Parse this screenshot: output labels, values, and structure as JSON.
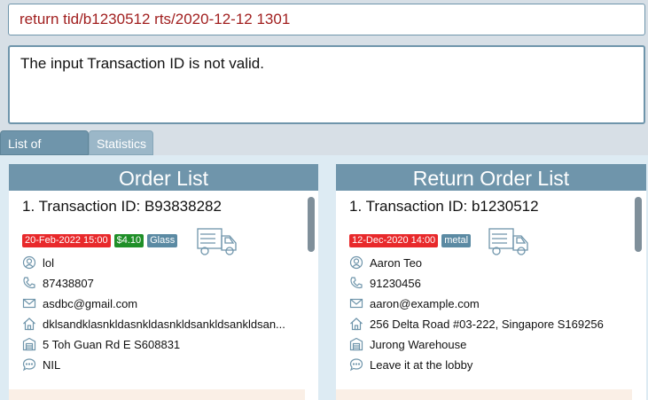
{
  "command": {
    "value": "return tid/b1230512 rts/2020-12-12 1301"
  },
  "result": {
    "text": "The input Transaction ID is not valid."
  },
  "tabs": [
    {
      "label": "List of Orders"
    },
    {
      "label": "Statistics"
    }
  ],
  "order_list": {
    "header": "Order List",
    "card": {
      "title": "1.  Transaction ID: B93838282",
      "tags": [
        {
          "text": "20-Feb-2022 15:00",
          "color": "#e8292b"
        },
        {
          "text": "$4.10",
          "color": "#1f8f28"
        },
        {
          "text": "Glass",
          "color": "#5b8aa3"
        }
      ],
      "truck_icon": "delivery-truck-icon",
      "name": "lol",
      "phone": "87438807",
      "email": "asdbc@gmail.com",
      "address": "dklsandklasnkldasnkldasnkldsankldsankldsan...",
      "warehouse": "5 Toh Guan Rd E S608831",
      "remark": "NIL"
    }
  },
  "return_list": {
    "header": "Return Order List",
    "card": {
      "title": "1.  Transaction ID: b1230512",
      "tags": [
        {
          "text": "12-Dec-2020 14:00",
          "color": "#e8292b"
        },
        {
          "text": "metal",
          "color": "#5b8aa3"
        }
      ],
      "truck_icon": "delivery-truck-icon",
      "name": "Aaron Teo",
      "phone": "91230456",
      "email": "aaron@example.com",
      "address": "256 Delta Road #03-222, Singapore S169256",
      "warehouse": "Jurong Warehouse",
      "remark": "Leave it at the lobby"
    }
  }
}
